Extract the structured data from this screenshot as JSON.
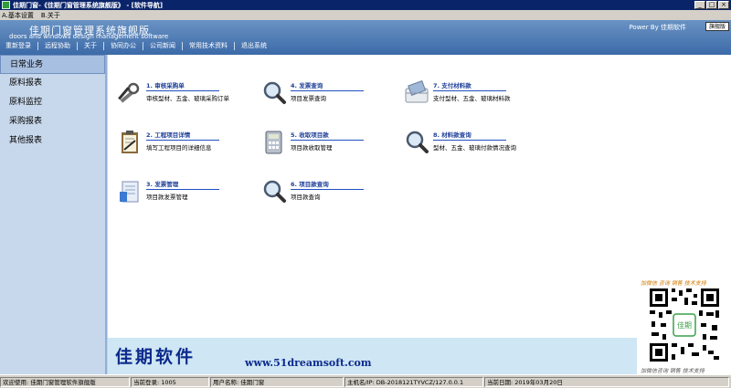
{
  "window": {
    "title": "佳期门窗-《佳期门窗管理系统旗舰版》 - [软件导航]",
    "min": "_",
    "max": "□",
    "close": "×"
  },
  "menu": [
    "A.基本设置",
    "B.关于"
  ],
  "header": {
    "brand_cn": "佳期门窗管理系统旗舰版",
    "brand_en": "doors and windows design management software",
    "power": "Power By 佳期软件",
    "edition": "旗舰版",
    "nav": [
      "重新登录",
      "远程协助",
      "关于",
      "协同办公",
      "公司新闻",
      "常用技术资料",
      "退出系统"
    ]
  },
  "sidebar": {
    "items": [
      "日常业务",
      "原料报表",
      "原料监控",
      "采购报表",
      "其他报表"
    ],
    "active_index": 0
  },
  "tiles": [
    {
      "title": "1. 审核采购单",
      "desc": "审核型材、五金、玻璃采购订单",
      "icon": "tools-icon"
    },
    {
      "title": "2. 工程项目详情",
      "desc": "填写工程项目的详细信息",
      "icon": "clipboard-icon"
    },
    {
      "title": "3. 发票管理",
      "desc": "项目款发票管理",
      "icon": "document-icon"
    },
    {
      "title": "4. 发票查询",
      "desc": "项目发票查询",
      "icon": "magnifier-icon"
    },
    {
      "title": "5. 收取项目款",
      "desc": "项目款收取管理",
      "icon": "calculator-icon"
    },
    {
      "title": "6. 项目款查询",
      "desc": "项目款查询",
      "icon": "magnifier-icon"
    },
    {
      "title": "7. 支付材料款",
      "desc": "支付型材、五金、玻璃材料款",
      "icon": "card-icon"
    },
    {
      "title": "8. 材料款查询",
      "desc": "型材、五金、玻璃付款情况查询",
      "icon": "magnifier-icon"
    }
  ],
  "footer": {
    "logo_cn": "佳期软件",
    "url": "www.51dreamsoft.com",
    "qr_top": "加微信 咨询 销售 技术支持",
    "qr_bottom": "加微信咨询 销售 技术支持",
    "qr_badge": "佳期"
  },
  "status": {
    "welcome": "欢迎使用: 佳期门窗管理软件旗舰版",
    "login": "当前登录: 1005",
    "user": "用户名称: 佳期门窗",
    "host": "主机名/IP: DB-2018121TYVCZ/127.0.0.1",
    "date": "当前日期: 2019年03月20日"
  }
}
